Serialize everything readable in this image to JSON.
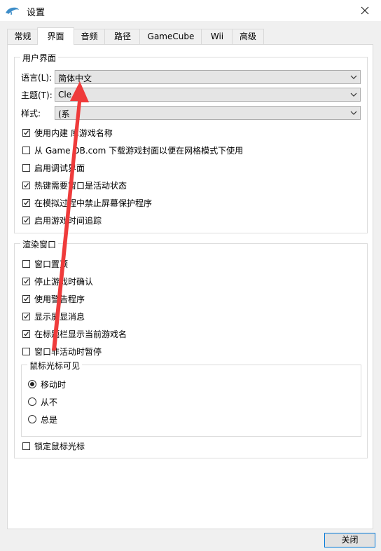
{
  "window": {
    "title": "设置",
    "close_icon": "close-icon"
  },
  "tabs": [
    "常规",
    "界面",
    "音频",
    "路径",
    "GameCube",
    "Wii",
    "高级"
  ],
  "active_tab": "界面",
  "user_interface": {
    "group_label": "用户界面",
    "language": {
      "label": "语言(L):",
      "value": "简体中文"
    },
    "theme": {
      "label": "主题(T):",
      "value": "Cle"
    },
    "style": {
      "label": "样式:",
      "value": "(系"
    },
    "checkboxes": [
      {
        "label": "使用内建   库游戏名称",
        "checked": true
      },
      {
        "label": "从 Game DB.com 下载游戏封面以便在网格模式下使用",
        "checked": false
      },
      {
        "label": "启用调试界面",
        "checked": false
      },
      {
        "label": "热键需要窗口是活动状态",
        "checked": true
      },
      {
        "label": "在模拟过程中禁止屏幕保护程序",
        "checked": true
      },
      {
        "label": "启用游戏时间追踪",
        "checked": true
      }
    ]
  },
  "render_window": {
    "group_label": "渲染窗口",
    "checkboxes": [
      {
        "label": "窗口置顶",
        "checked": false
      },
      {
        "label": "停止游戏时确认",
        "checked": true
      },
      {
        "label": "使用警告程序",
        "checked": true
      },
      {
        "label": "显示屏显消息",
        "checked": true
      },
      {
        "label": "在标题栏显示当前游戏名",
        "checked": true
      },
      {
        "label": "窗口非活动时暂停",
        "checked": false
      }
    ],
    "cursor": {
      "group_label": "鼠标光标可见",
      "options": [
        {
          "label": "移动时",
          "selected": true
        },
        {
          "label": "从不",
          "selected": false
        },
        {
          "label": "总是",
          "selected": false
        }
      ]
    },
    "lock_cursor": {
      "label": "锁定鼠标光标",
      "checked": false
    }
  },
  "footer": {
    "close_label": "关闭"
  },
  "annotation": {
    "arrow_color": "#ef3b3b"
  },
  "colors": {
    "accent": "#0078d7"
  }
}
